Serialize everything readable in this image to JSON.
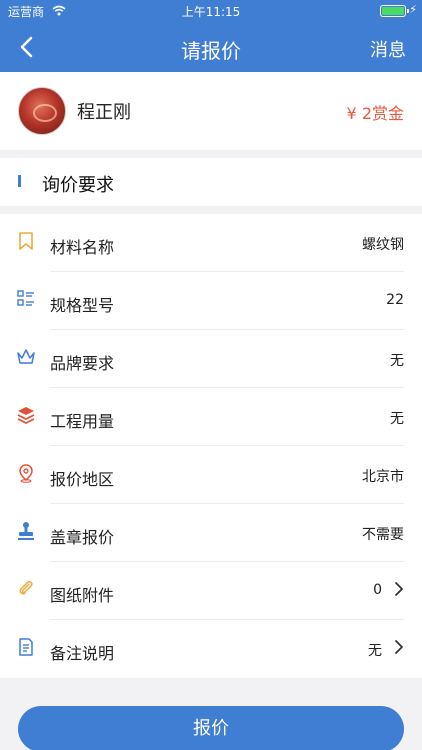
{
  "status_bar": {
    "carrier": "运营商",
    "time": "上午11:15"
  },
  "nav": {
    "title": "请报价",
    "right_label": "消息"
  },
  "user": {
    "name": "程正刚",
    "reward": "¥ 2赏金"
  },
  "section": {
    "title": "询价要求"
  },
  "rows": [
    {
      "label": "材料名称",
      "value": "螺纹钢",
      "icon": "bookmark-icon",
      "color": "#f0a93b"
    },
    {
      "label": "规格型号",
      "value": "22",
      "icon": "spec-list-icon",
      "color": "#3f7ed3"
    },
    {
      "label": "品牌要求",
      "value": "无",
      "icon": "crown-icon",
      "color": "#3f7ed3"
    },
    {
      "label": "工程用量",
      "value": "无",
      "icon": "layers-icon",
      "color": "#e0523a"
    },
    {
      "label": "报价地区",
      "value": "北京市",
      "icon": "location-pin-icon",
      "color": "#e0523a"
    },
    {
      "label": "盖章报价",
      "value": "不需要",
      "icon": "stamp-icon",
      "color": "#3f7ed3"
    },
    {
      "label": "图纸附件",
      "value": "0",
      "icon": "paperclip-icon",
      "color": "#f0a93b"
    },
    {
      "label": "备注说明",
      "value": "无",
      "icon": "note-icon",
      "color": "#3f7ed3"
    }
  ],
  "submit_label": "报价",
  "colors": {
    "primary": "#3f7ed3",
    "accent": "#e85a3c"
  }
}
